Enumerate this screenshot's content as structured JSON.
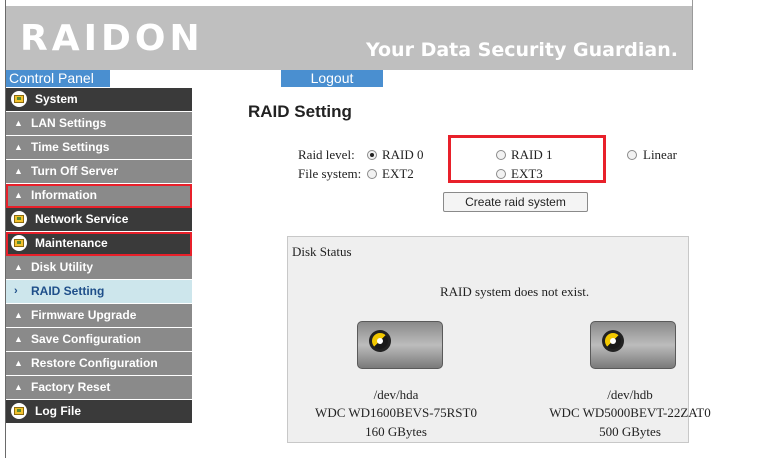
{
  "header": {
    "logo": "RAIDON",
    "tagline": "Your Data Security Guardian.",
    "control_panel": "Control Panel",
    "logout": "Logout"
  },
  "sidebar": {
    "items": [
      {
        "label": "System",
        "kind": "category",
        "icon": "folder-icon"
      },
      {
        "label": "LAN Settings",
        "kind": "sub",
        "icon": "chevron-up-icon"
      },
      {
        "label": "Time Settings",
        "kind": "sub",
        "icon": "chevron-up-icon"
      },
      {
        "label": "Turn Off Server",
        "kind": "sub",
        "icon": "chevron-up-icon"
      },
      {
        "label": "Information",
        "kind": "sub",
        "icon": "chevron-up-icon",
        "highlighted": true
      },
      {
        "label": "Network Service",
        "kind": "category",
        "icon": "folder-icon"
      },
      {
        "label": "Maintenance",
        "kind": "category",
        "icon": "folder-icon",
        "highlighted": true
      },
      {
        "label": "Disk Utility",
        "kind": "sub",
        "icon": "chevron-up-icon"
      },
      {
        "label": "RAID Setting",
        "kind": "sub",
        "icon": "chevron-right-icon",
        "active": true
      },
      {
        "label": "Firmware Upgrade",
        "kind": "sub",
        "icon": "chevron-up-icon"
      },
      {
        "label": "Save Configuration",
        "kind": "sub",
        "icon": "chevron-up-icon"
      },
      {
        "label": "Restore Configuration",
        "kind": "sub",
        "icon": "chevron-up-icon"
      },
      {
        "label": "Factory Reset",
        "kind": "sub",
        "icon": "chevron-up-icon"
      },
      {
        "label": "Log File",
        "kind": "category",
        "icon": "folder-icon"
      }
    ]
  },
  "main": {
    "title": "RAID Setting",
    "raid_level_label": "Raid level:",
    "file_system_label": "File system:",
    "raid_options": [
      {
        "label": "RAID 0",
        "checked": true
      },
      {
        "label": "RAID 1",
        "checked": false
      },
      {
        "label": "Linear",
        "checked": false
      }
    ],
    "fs_options": [
      {
        "label": "EXT2",
        "checked": false
      },
      {
        "label": "EXT3",
        "checked": false
      }
    ],
    "create_button": "Create raid system"
  },
  "disk_status": {
    "title": "Disk Status",
    "message": "RAID system does not exist.",
    "disks": [
      {
        "device": "/dev/hda",
        "model": "WDC WD1600BEVS-75RST0",
        "size": "160 GBytes"
      },
      {
        "device": "/dev/hdb",
        "model": "WDC WD5000BEVT-22ZAT0",
        "size": "500 GBytes"
      }
    ]
  },
  "colors": {
    "header_bg": "#bfbfbf",
    "accent_blue": "#4a8fd0",
    "menu_category": "#3a3a3a",
    "menu_sub": "#8a8a8a",
    "menu_active": "#cde6ec",
    "highlight_red": "#e8202a"
  }
}
